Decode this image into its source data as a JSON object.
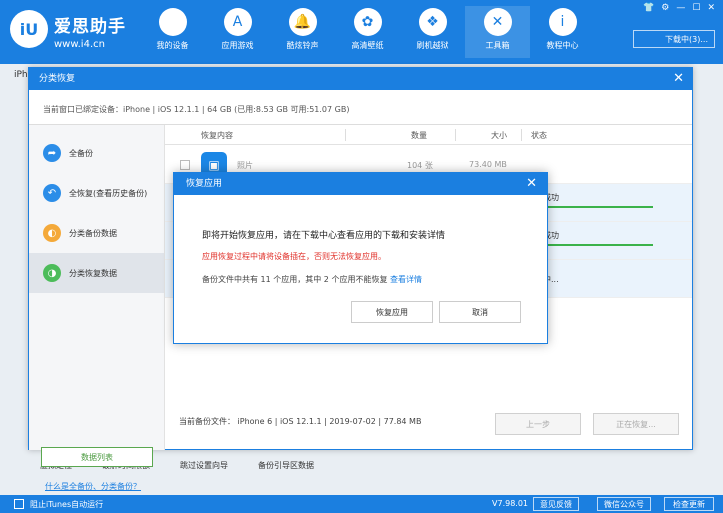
{
  "header": {
    "brand_name": "爱思助手",
    "brand_url": "www.i4.cn",
    "logo_text": "iU",
    "nav": [
      {
        "label": "我的设备",
        "icon": "apple-icon",
        "glyph": ""
      },
      {
        "label": "应用游戏",
        "icon": "app-store-icon",
        "glyph": "A"
      },
      {
        "label": "酷炫铃声",
        "icon": "bell-icon",
        "glyph": "🔔"
      },
      {
        "label": "高清壁纸",
        "icon": "flower-icon",
        "glyph": "✿"
      },
      {
        "label": "刷机越狱",
        "icon": "box-icon",
        "glyph": "❖"
      },
      {
        "label": "工具箱",
        "icon": "tools-icon",
        "glyph": "✕"
      },
      {
        "label": "教程中心",
        "icon": "info-icon",
        "glyph": "i"
      }
    ],
    "window_controls": [
      "👕",
      "⚙",
      "—",
      "☐",
      "✕"
    ],
    "download_label": "下载中(3)..."
  },
  "background": {
    "tab_label": "iPh",
    "links": [
      "虚拟定位",
      "破解时间限额",
      "跳过设置向导",
      "备份引导区数据"
    ]
  },
  "statusbar": {
    "itunes_label": "阻止iTunes自动运行",
    "version": "V7.98.01",
    "buttons": [
      "意见反馈",
      "微信公众号",
      "检查更新"
    ]
  },
  "dialog": {
    "title": "分类恢复",
    "close": "✕",
    "device_info": "当前窗口已绑定设备：iPhone  |  iOS 12.1.1  |  64 GB (已用:8.53 GB 可用:51.07 GB)",
    "sidebar": [
      {
        "label": "全备份",
        "glyph": "➦",
        "color": "#2b8de8"
      },
      {
        "label": "全恢复(查看历史备份)",
        "glyph": "↶",
        "color": "#2b8de8"
      },
      {
        "label": "分类备份数据",
        "glyph": "◐",
        "color": "#f4a93a"
      },
      {
        "label": "分类恢复数据",
        "glyph": "◑",
        "color": "#4cbc5a"
      }
    ],
    "sidebar_button": "数据列表",
    "sidebar_link": "什么是全备份、分类备份？",
    "table": {
      "headers": [
        "恢复内容",
        "数量",
        "大小",
        "状态"
      ],
      "rows": [
        {
          "name": "照片",
          "count": "104 张",
          "size": "73.40 MB",
          "status": ""
        },
        {
          "name": "",
          "count": "",
          "size": "",
          "status": "成功"
        },
        {
          "name": "",
          "count": "",
          "size": "",
          "status": "成功"
        },
        {
          "name": "",
          "count": "",
          "size": "",
          "status": "中..."
        }
      ]
    },
    "footer_info": "当前备份文件： iPhone 6 | iOS 12.1.1 | 2019-07-02 | 77.84 MB",
    "prev_label": "上一步",
    "restoring_label": "正在恢复..."
  },
  "modal": {
    "title": "恢复应用",
    "close": "✕",
    "line1": "即将开始恢复应用，请在下载中心查看应用的下载和安装详情",
    "line2": "应用恢复过程中请将设备插在，否则无法恢复应用。",
    "line3": "备份文件中共有 11 个应用，其中 2 个应用不能恢复",
    "line3_link": "查看详情",
    "confirm_label": "恢复应用",
    "cancel_label": "取消"
  }
}
